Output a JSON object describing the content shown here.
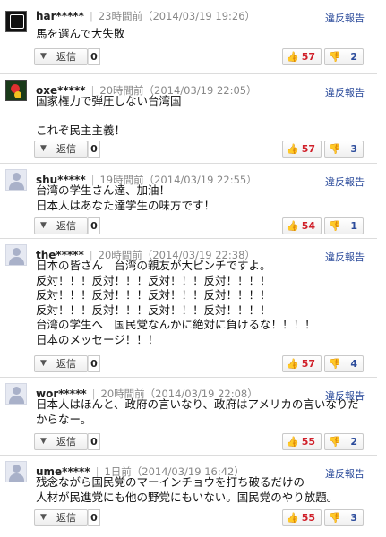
{
  "labels": {
    "report": "違反報告",
    "reply": "返信"
  },
  "comments": [
    {
      "user": "har*****",
      "time": "23時間前（2014/03/19 19:26）",
      "body": "馬を選んで大失敗",
      "replies": "0",
      "likes": "57",
      "dislikes": "2"
    },
    {
      "user": "oxe*****",
      "time": "20時間前（2014/03/19 22:05）",
      "body": "国家権力で弾圧しない台湾国\n\nこれぞ民主主義！",
      "replies": "0",
      "likes": "57",
      "dislikes": "3"
    },
    {
      "user": "shu*****",
      "time": "19時間前（2014/03/19 22:55）",
      "body": "台湾の学生さん達、加油！\n日本人はあなた達学生の味方です！",
      "replies": "0",
      "likes": "54",
      "dislikes": "1"
    },
    {
      "user": "the*****",
      "time": "20時間前（2014/03/19 22:38）",
      "body": "日本の皆さん　台湾の親友が大ピンチですよ。\n反対！！！反対！！！反対！！！反対！！！！\n反対！！！反対！！！反対！！！反対！！！！\n反対！！！反対！！！反対！！！反対！！！！\n台湾の学生へ　国民党なんかに絶対に負けるな！！！！\n日本のメッセージ！！！",
      "replies": "0",
      "likes": "57",
      "dislikes": "4"
    },
    {
      "user": "wor*****",
      "time": "20時間前（2014/03/19 22:08）",
      "body": "日本人はほんと、政府の言いなり、政府はアメリカの言いなりだ\nからなー。",
      "replies": "0",
      "likes": "55",
      "dislikes": "2"
    },
    {
      "user": "ume*****",
      "time": "1日前（2014/03/19 16:42）",
      "body": "残念ながら国民党のマーインチョウを打ち破るだけの\n人材が民進党にも他の野党にもいない。国民党のやり放題。",
      "replies": "0",
      "likes": "55",
      "dislikes": "3"
    }
  ]
}
